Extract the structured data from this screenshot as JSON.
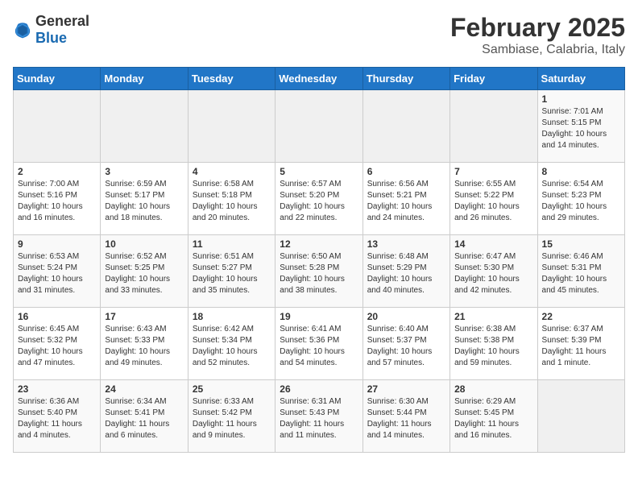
{
  "logo": {
    "general": "General",
    "blue": "Blue"
  },
  "title": "February 2025",
  "subtitle": "Sambiase, Calabria, Italy",
  "days_of_week": [
    "Sunday",
    "Monday",
    "Tuesday",
    "Wednesday",
    "Thursday",
    "Friday",
    "Saturday"
  ],
  "weeks": [
    [
      {
        "day": "",
        "info": ""
      },
      {
        "day": "",
        "info": ""
      },
      {
        "day": "",
        "info": ""
      },
      {
        "day": "",
        "info": ""
      },
      {
        "day": "",
        "info": ""
      },
      {
        "day": "",
        "info": ""
      },
      {
        "day": "1",
        "info": "Sunrise: 7:01 AM\nSunset: 5:15 PM\nDaylight: 10 hours and 14 minutes."
      }
    ],
    [
      {
        "day": "2",
        "info": "Sunrise: 7:00 AM\nSunset: 5:16 PM\nDaylight: 10 hours and 16 minutes."
      },
      {
        "day": "3",
        "info": "Sunrise: 6:59 AM\nSunset: 5:17 PM\nDaylight: 10 hours and 18 minutes."
      },
      {
        "day": "4",
        "info": "Sunrise: 6:58 AM\nSunset: 5:18 PM\nDaylight: 10 hours and 20 minutes."
      },
      {
        "day": "5",
        "info": "Sunrise: 6:57 AM\nSunset: 5:20 PM\nDaylight: 10 hours and 22 minutes."
      },
      {
        "day": "6",
        "info": "Sunrise: 6:56 AM\nSunset: 5:21 PM\nDaylight: 10 hours and 24 minutes."
      },
      {
        "day": "7",
        "info": "Sunrise: 6:55 AM\nSunset: 5:22 PM\nDaylight: 10 hours and 26 minutes."
      },
      {
        "day": "8",
        "info": "Sunrise: 6:54 AM\nSunset: 5:23 PM\nDaylight: 10 hours and 29 minutes."
      }
    ],
    [
      {
        "day": "9",
        "info": "Sunrise: 6:53 AM\nSunset: 5:24 PM\nDaylight: 10 hours and 31 minutes."
      },
      {
        "day": "10",
        "info": "Sunrise: 6:52 AM\nSunset: 5:25 PM\nDaylight: 10 hours and 33 minutes."
      },
      {
        "day": "11",
        "info": "Sunrise: 6:51 AM\nSunset: 5:27 PM\nDaylight: 10 hours and 35 minutes."
      },
      {
        "day": "12",
        "info": "Sunrise: 6:50 AM\nSunset: 5:28 PM\nDaylight: 10 hours and 38 minutes."
      },
      {
        "day": "13",
        "info": "Sunrise: 6:48 AM\nSunset: 5:29 PM\nDaylight: 10 hours and 40 minutes."
      },
      {
        "day": "14",
        "info": "Sunrise: 6:47 AM\nSunset: 5:30 PM\nDaylight: 10 hours and 42 minutes."
      },
      {
        "day": "15",
        "info": "Sunrise: 6:46 AM\nSunset: 5:31 PM\nDaylight: 10 hours and 45 minutes."
      }
    ],
    [
      {
        "day": "16",
        "info": "Sunrise: 6:45 AM\nSunset: 5:32 PM\nDaylight: 10 hours and 47 minutes."
      },
      {
        "day": "17",
        "info": "Sunrise: 6:43 AM\nSunset: 5:33 PM\nDaylight: 10 hours and 49 minutes."
      },
      {
        "day": "18",
        "info": "Sunrise: 6:42 AM\nSunset: 5:34 PM\nDaylight: 10 hours and 52 minutes."
      },
      {
        "day": "19",
        "info": "Sunrise: 6:41 AM\nSunset: 5:36 PM\nDaylight: 10 hours and 54 minutes."
      },
      {
        "day": "20",
        "info": "Sunrise: 6:40 AM\nSunset: 5:37 PM\nDaylight: 10 hours and 57 minutes."
      },
      {
        "day": "21",
        "info": "Sunrise: 6:38 AM\nSunset: 5:38 PM\nDaylight: 10 hours and 59 minutes."
      },
      {
        "day": "22",
        "info": "Sunrise: 6:37 AM\nSunset: 5:39 PM\nDaylight: 11 hours and 1 minute."
      }
    ],
    [
      {
        "day": "23",
        "info": "Sunrise: 6:36 AM\nSunset: 5:40 PM\nDaylight: 11 hours and 4 minutes."
      },
      {
        "day": "24",
        "info": "Sunrise: 6:34 AM\nSunset: 5:41 PM\nDaylight: 11 hours and 6 minutes."
      },
      {
        "day": "25",
        "info": "Sunrise: 6:33 AM\nSunset: 5:42 PM\nDaylight: 11 hours and 9 minutes."
      },
      {
        "day": "26",
        "info": "Sunrise: 6:31 AM\nSunset: 5:43 PM\nDaylight: 11 hours and 11 minutes."
      },
      {
        "day": "27",
        "info": "Sunrise: 6:30 AM\nSunset: 5:44 PM\nDaylight: 11 hours and 14 minutes."
      },
      {
        "day": "28",
        "info": "Sunrise: 6:29 AM\nSunset: 5:45 PM\nDaylight: 11 hours and 16 minutes."
      },
      {
        "day": "",
        "info": ""
      }
    ]
  ]
}
